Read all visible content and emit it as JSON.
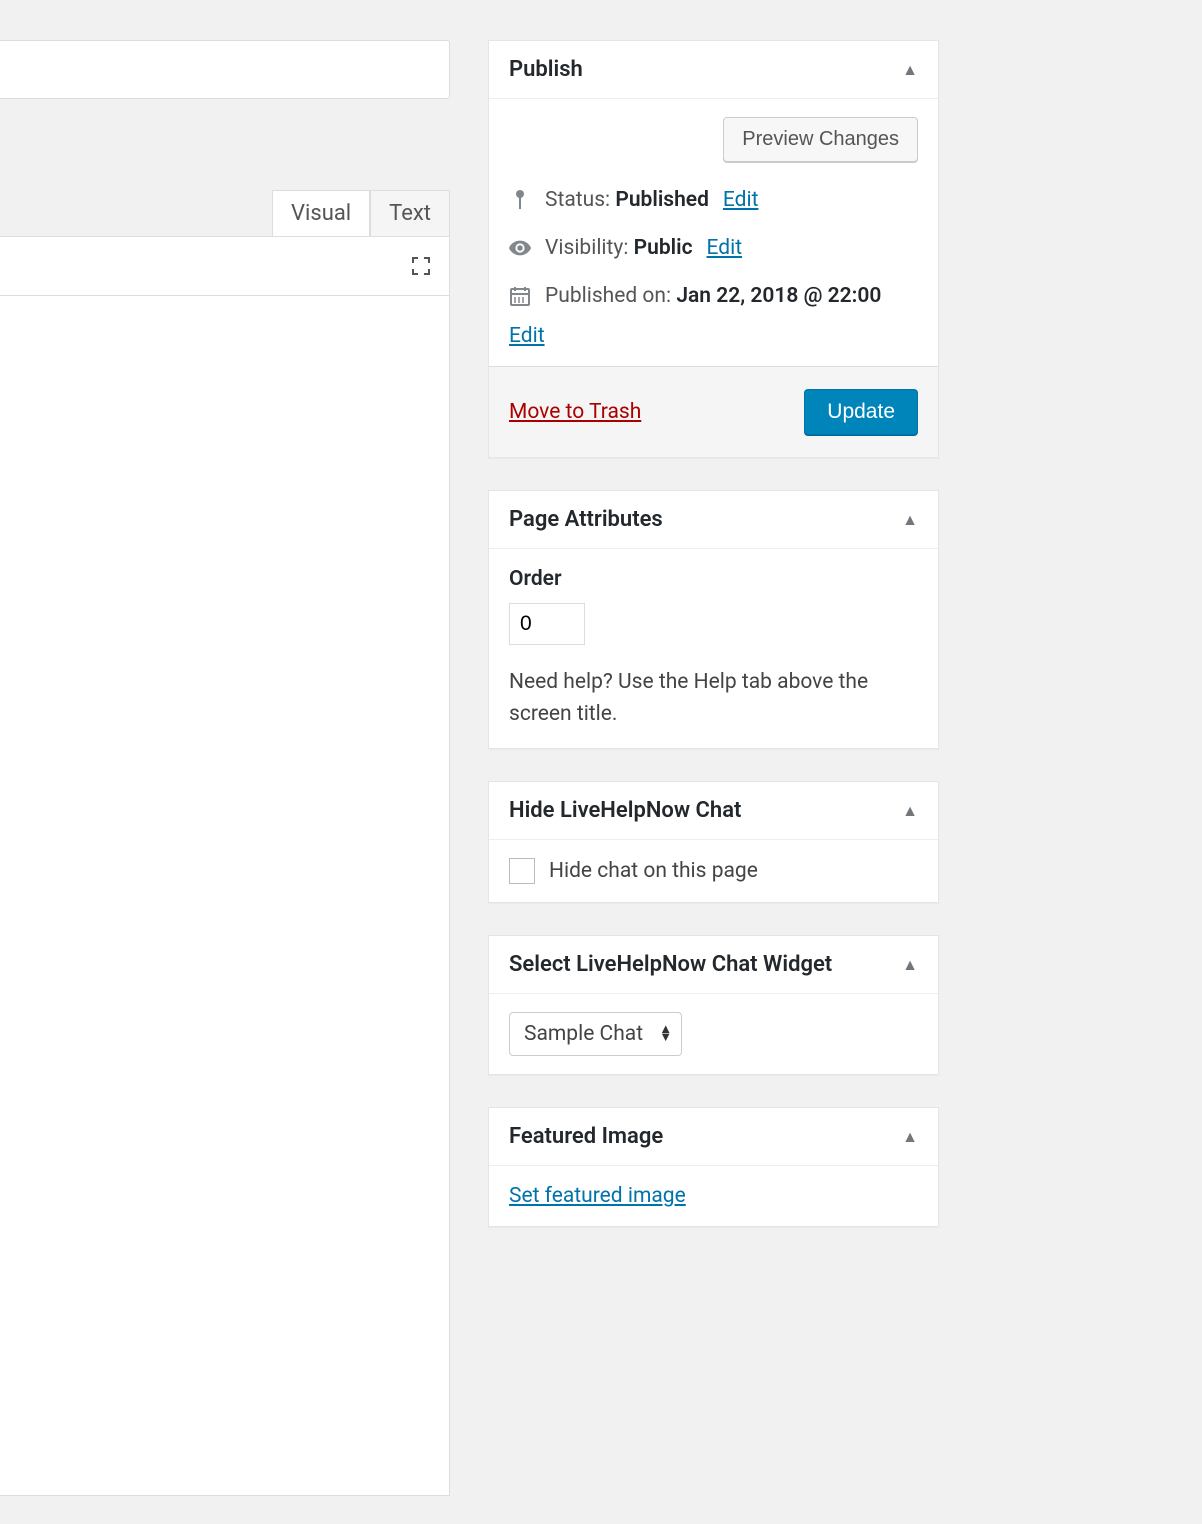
{
  "editor": {
    "tabs": {
      "visual": "Visual",
      "text": "Text"
    }
  },
  "publish": {
    "title": "Publish",
    "preview_button": "Preview Changes",
    "status_label": "Status:",
    "status_value": "Published",
    "visibility_label": "Visibility:",
    "visibility_value": "Public",
    "published_on_label": "Published on:",
    "published_on_value": "Jan 22, 2018 @ 22:00",
    "edit": "Edit",
    "trash": "Move to Trash",
    "update": "Update"
  },
  "page_attributes": {
    "title": "Page Attributes",
    "order_label": "Order",
    "order_value": "0",
    "help_text": "Need help? Use the Help tab above the screen title."
  },
  "hide_chat": {
    "title": "Hide LiveHelpNow Chat",
    "checkbox_label": "Hide chat on this page"
  },
  "select_widget": {
    "title": "Select LiveHelpNow Chat Widget",
    "selected": "Sample Chat"
  },
  "featured_image": {
    "title": "Featured Image",
    "set_link": "Set featured image"
  }
}
